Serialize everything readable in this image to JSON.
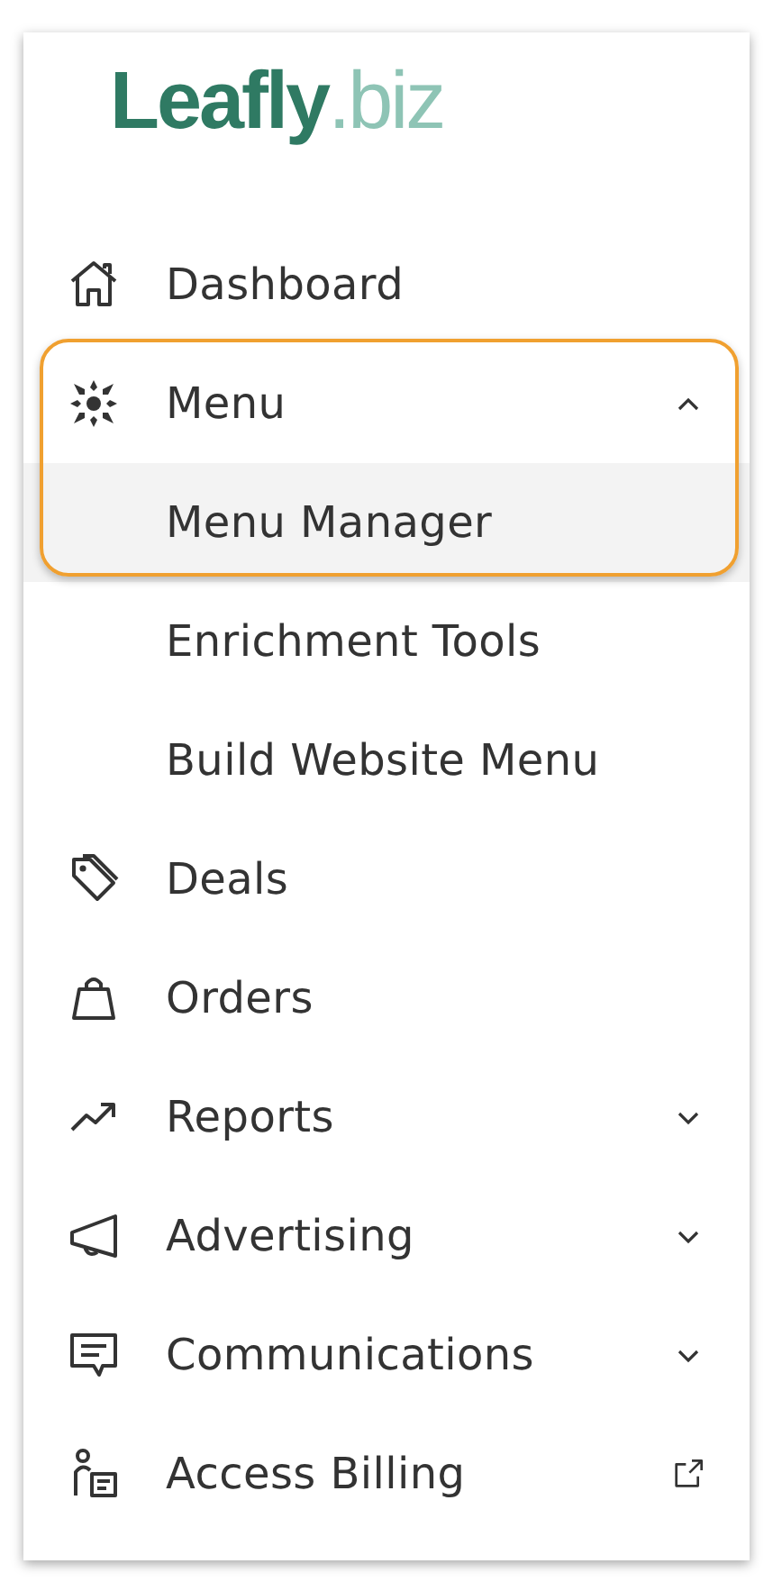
{
  "logo": {
    "brand": "Leafly",
    "suffix": ".biz"
  },
  "items": [
    {
      "kind": "link",
      "label": "Dashboard"
    },
    {
      "kind": "group",
      "label": "Menu",
      "expanded": true,
      "highlighted": true,
      "children": [
        {
          "label": "Menu Manager",
          "selected": true
        },
        {
          "label": "Enrichment Tools",
          "selected": false
        },
        {
          "label": "Build Website Menu",
          "selected": false
        }
      ]
    },
    {
      "kind": "link",
      "label": "Deals"
    },
    {
      "kind": "link",
      "label": "Orders"
    },
    {
      "kind": "group",
      "label": "Reports",
      "expanded": false
    },
    {
      "kind": "group",
      "label": "Advertising",
      "expanded": false
    },
    {
      "kind": "group",
      "label": "Communications",
      "expanded": false
    },
    {
      "kind": "external",
      "label": "Access Billing"
    }
  ]
}
